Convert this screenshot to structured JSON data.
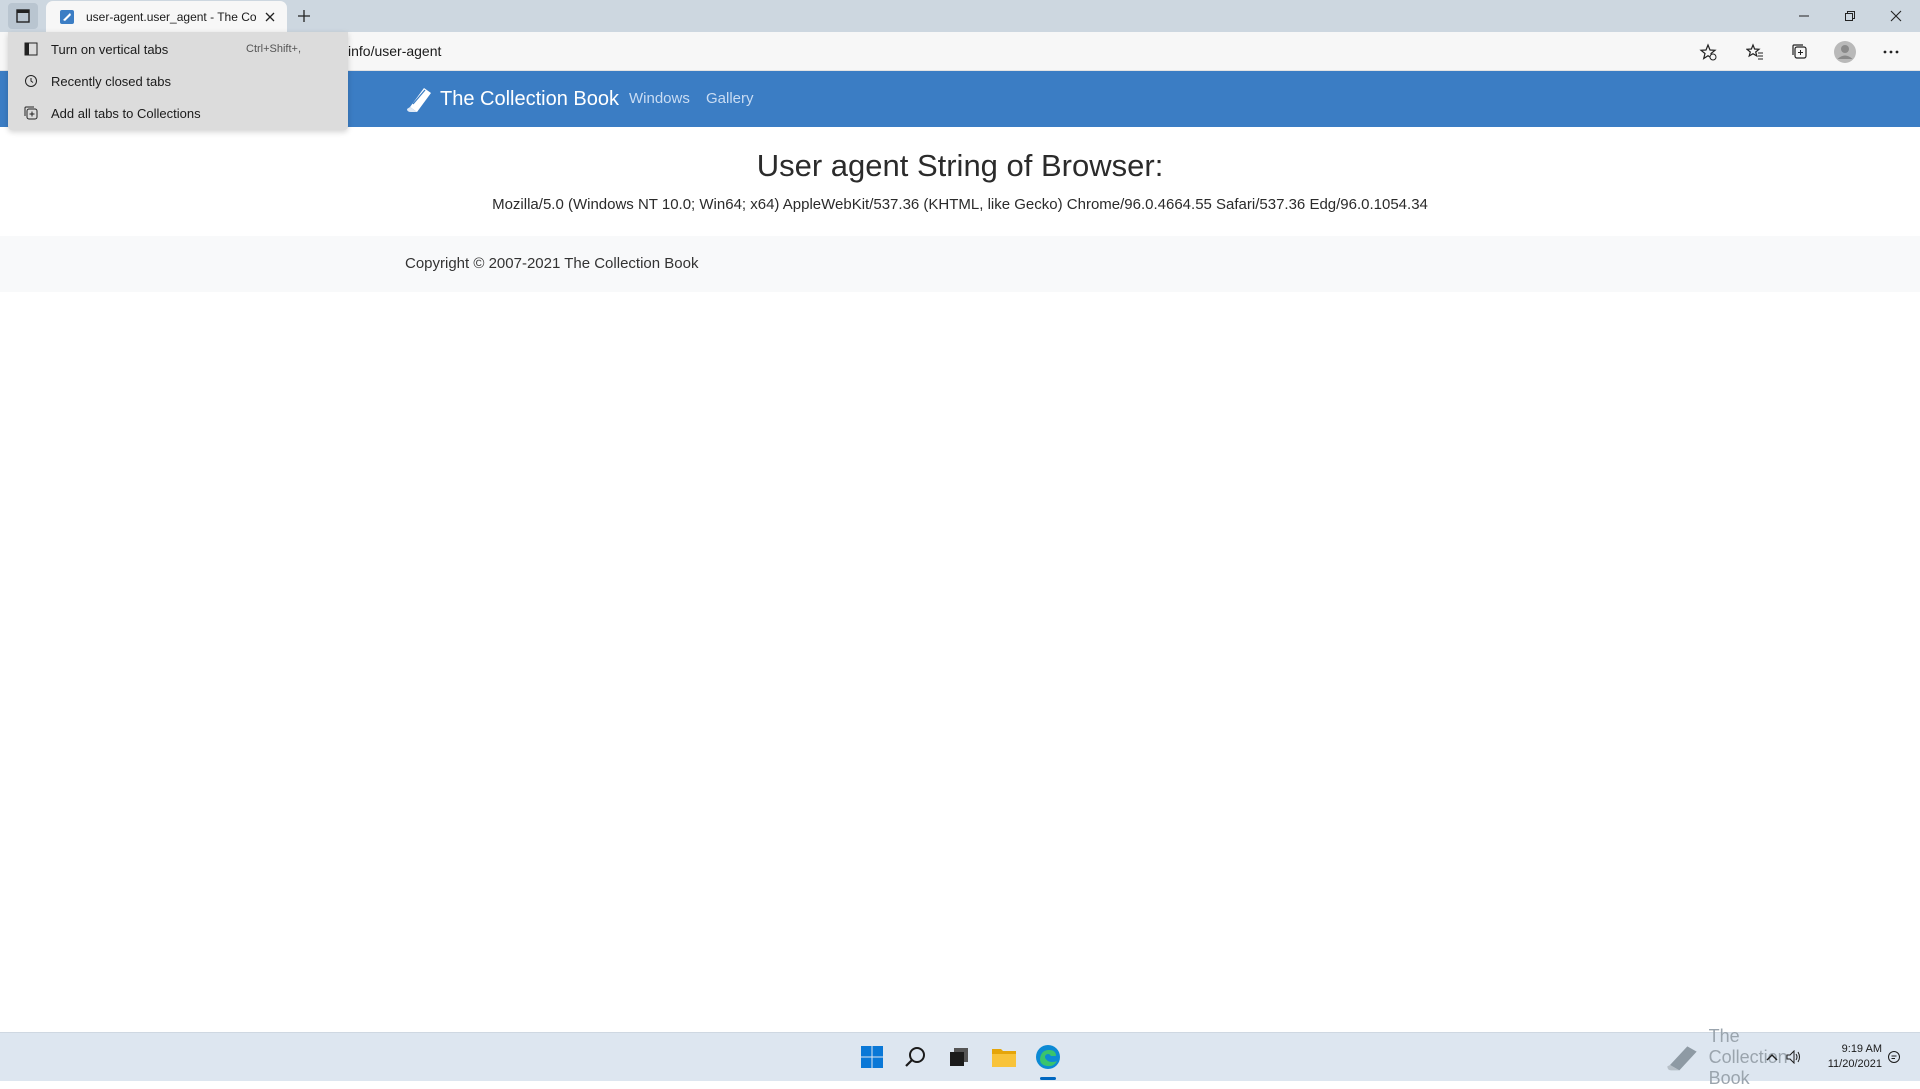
{
  "browser": {
    "tab_title": "user-agent.user_agent - The Coll",
    "url_visible": "info/user-agent",
    "tab_actions_menu": [
      {
        "label": "Turn on vertical tabs",
        "shortcut": "Ctrl+Shift+,",
        "icon": "vertical-tabs-icon"
      },
      {
        "label": "Recently closed tabs",
        "shortcut": "",
        "icon": "history-icon"
      },
      {
        "label": "Add all tabs to Collections",
        "shortcut": "",
        "icon": "collections-icon"
      }
    ]
  },
  "site": {
    "brand": "The Collection Book",
    "nav": [
      "Windows",
      "Gallery"
    ],
    "heading": "User agent String of Browser:",
    "user_agent": "Mozilla/5.0 (Windows NT 10.0; Win64; x64) AppleWebKit/537.36 (KHTML, like Gecko) Chrome/96.0.4664.55 Safari/537.36 Edg/96.0.1054.34",
    "copyright": "Copyright © 2007-2021 The Collection Book",
    "navbar_color": "#3b7dc4"
  },
  "taskbar": {
    "time": "9:19 AM",
    "date": "11/20/2021",
    "watermark": "The Collection Book",
    "icons": [
      "windows-start-icon",
      "search-icon",
      "task-view-icon",
      "file-explorer-icon",
      "edge-browser-icon"
    ]
  }
}
